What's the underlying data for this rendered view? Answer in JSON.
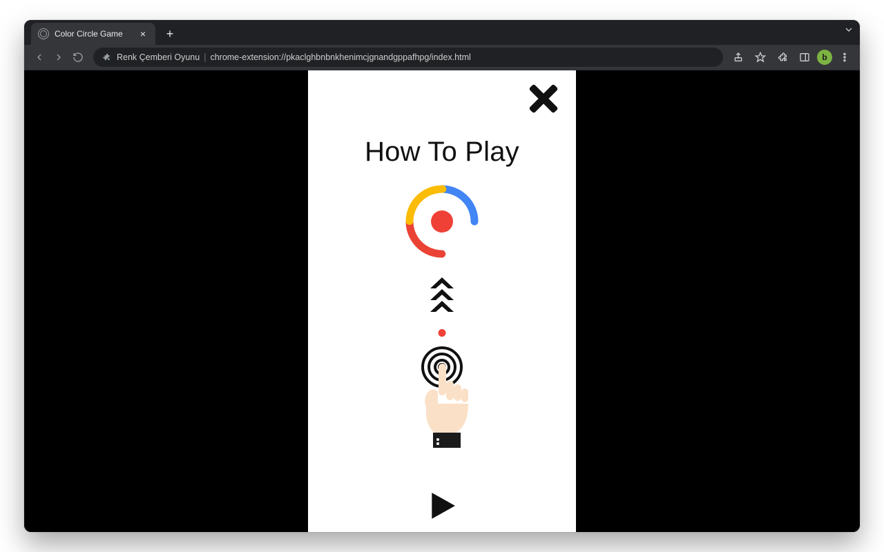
{
  "browser": {
    "tab_title": "Color Circle Game",
    "url_label": "Renk Çemberi Oyunu",
    "url_path": "chrome-extension://pkaclghbnbnkhenimcjgnandgppafhpg/index.html",
    "profile_initial": "b"
  },
  "game": {
    "title": "How To Play",
    "colors": {
      "blue": "#4285f4",
      "green": "#34a853",
      "red": "#ea4335",
      "yellow": "#fbbc05",
      "dot": "#ef4136",
      "skin": "#fbe0c8",
      "cuff": "#1b1b1b"
    }
  }
}
